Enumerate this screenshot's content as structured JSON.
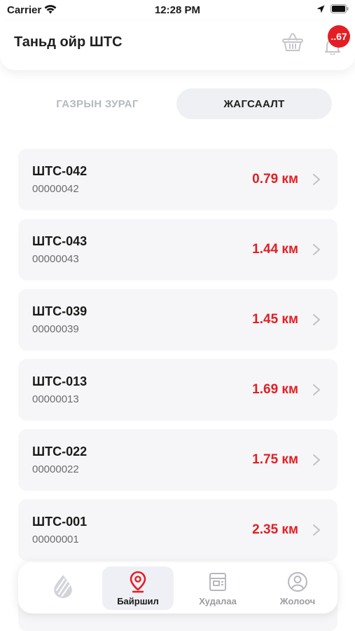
{
  "status_bar": {
    "carrier": "Carrier",
    "time": "12:28 PM"
  },
  "header": {
    "title": "Таньд ойр ШТС",
    "notification_count": "..67",
    "basket_icon": "basket-icon",
    "bell_icon": "bell-icon"
  },
  "tabs": {
    "map_label": "ГАЗРЫН ЗУРАГ",
    "list_label": "ЖАГСААЛТ",
    "active": "list"
  },
  "stations": [
    {
      "name": "ШТС-042",
      "code": "00000042",
      "distance": "0.79 км"
    },
    {
      "name": "ШТС-043",
      "code": "00000043",
      "distance": "1.44 км"
    },
    {
      "name": "ШТС-039",
      "code": "00000039",
      "distance": "1.45 км"
    },
    {
      "name": "ШТС-013",
      "code": "00000013",
      "distance": "1.69 км"
    },
    {
      "name": "ШТС-022",
      "code": "00000022",
      "distance": "1.75 км"
    },
    {
      "name": "ШТС-001",
      "code": "00000001",
      "distance": "2.35 км"
    }
  ],
  "bottom_nav": {
    "items": [
      {
        "label": "",
        "icon": "drop-logo-icon"
      },
      {
        "label": "Байршил",
        "icon": "map-pin-icon",
        "active": true
      },
      {
        "label": "Худалаа",
        "icon": "store-icon"
      },
      {
        "label": "Жолооч",
        "icon": "user-icon"
      }
    ]
  },
  "colors": {
    "accent": "#e31e24",
    "card_bg": "#f6f6f8",
    "tab_active_bg": "#eef0f3"
  }
}
